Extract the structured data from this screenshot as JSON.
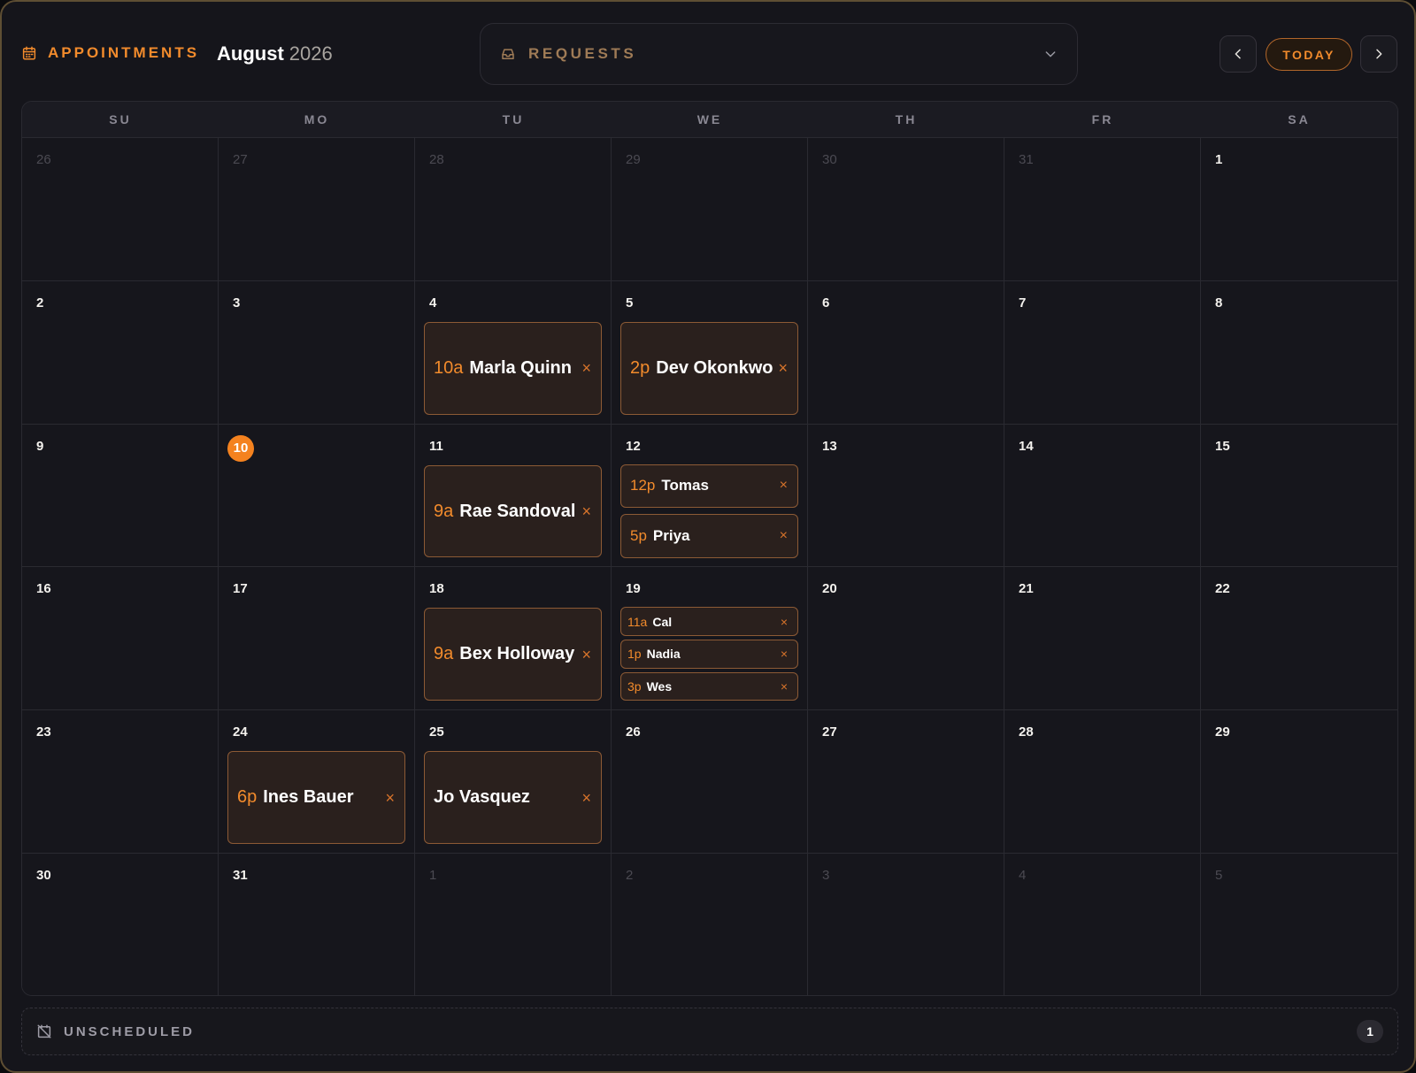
{
  "header": {
    "brand_label": "APPOINTMENTS",
    "month": "August",
    "year": "2026",
    "requests_label": "REQUESTS",
    "today_label": "TODAY",
    "icons": {
      "brand": "calendar-icon",
      "requests": "inbox-tray-icon",
      "dropdown": "chevron-down-icon",
      "prev": "chevron-left-icon",
      "next": "chevron-right-icon"
    }
  },
  "colors": {
    "accent": "#f28b2c",
    "background": "#15151b",
    "event_fill": "#2a201d",
    "event_border": "#8c5a35",
    "today_badge": "#f4821f"
  },
  "calendar": {
    "weekdays": [
      "SU",
      "MO",
      "TU",
      "WE",
      "TH",
      "FR",
      "SA"
    ],
    "today": "10",
    "days": [
      {
        "day": "26",
        "out": true,
        "events": []
      },
      {
        "day": "27",
        "out": true,
        "events": []
      },
      {
        "day": "28",
        "out": true,
        "events": []
      },
      {
        "day": "29",
        "out": true,
        "events": []
      },
      {
        "day": "30",
        "out": true,
        "events": []
      },
      {
        "day": "31",
        "out": true,
        "events": []
      },
      {
        "day": "1",
        "out": false,
        "events": []
      },
      {
        "day": "2",
        "out": false,
        "events": []
      },
      {
        "day": "3",
        "out": false,
        "events": []
      },
      {
        "day": "4",
        "out": false,
        "events": [
          {
            "time": "10a",
            "name": "Marla Quinn"
          }
        ]
      },
      {
        "day": "5",
        "out": false,
        "events": [
          {
            "time": "2p",
            "name": "Dev Okonkwo"
          }
        ]
      },
      {
        "day": "6",
        "out": false,
        "events": []
      },
      {
        "day": "7",
        "out": false,
        "events": []
      },
      {
        "day": "8",
        "out": false,
        "events": []
      },
      {
        "day": "9",
        "out": false,
        "events": []
      },
      {
        "day": "10",
        "out": false,
        "events": []
      },
      {
        "day": "11",
        "out": false,
        "events": [
          {
            "time": "9a",
            "name": "Rae Sandoval"
          }
        ]
      },
      {
        "day": "12",
        "out": false,
        "events": [
          {
            "time": "12p",
            "name": "Tomas"
          },
          {
            "time": "5p",
            "name": "Priya"
          }
        ]
      },
      {
        "day": "13",
        "out": false,
        "events": []
      },
      {
        "day": "14",
        "out": false,
        "events": []
      },
      {
        "day": "15",
        "out": false,
        "events": []
      },
      {
        "day": "16",
        "out": false,
        "events": []
      },
      {
        "day": "17",
        "out": false,
        "events": []
      },
      {
        "day": "18",
        "out": false,
        "events": [
          {
            "time": "9a",
            "name": "Bex Holloway"
          }
        ]
      },
      {
        "day": "19",
        "out": false,
        "events": [
          {
            "time": "11a",
            "name": "Cal"
          },
          {
            "time": "1p",
            "name": "Nadia"
          },
          {
            "time": "3p",
            "name": "Wes"
          }
        ]
      },
      {
        "day": "20",
        "out": false,
        "events": []
      },
      {
        "day": "21",
        "out": false,
        "events": []
      },
      {
        "day": "22",
        "out": false,
        "events": []
      },
      {
        "day": "23",
        "out": false,
        "events": []
      },
      {
        "day": "24",
        "out": false,
        "events": [
          {
            "time": "6p",
            "name": "Ines Bauer"
          }
        ]
      },
      {
        "day": "25",
        "out": false,
        "events": [
          {
            "time": "",
            "name": "Jo Vasquez"
          }
        ]
      },
      {
        "day": "26",
        "out": false,
        "events": []
      },
      {
        "day": "27",
        "out": false,
        "events": []
      },
      {
        "day": "28",
        "out": false,
        "events": []
      },
      {
        "day": "29",
        "out": false,
        "events": []
      },
      {
        "day": "30",
        "out": false,
        "events": []
      },
      {
        "day": "31",
        "out": false,
        "events": []
      },
      {
        "day": "1",
        "out": true,
        "events": []
      },
      {
        "day": "2",
        "out": true,
        "events": []
      },
      {
        "day": "3",
        "out": true,
        "events": []
      },
      {
        "day": "4",
        "out": true,
        "events": []
      },
      {
        "day": "5",
        "out": true,
        "events": []
      }
    ]
  },
  "unscheduled": {
    "label": "UNSCHEDULED",
    "count": "1",
    "icon": "calendar-off-icon"
  },
  "event_remove_glyph": "×"
}
